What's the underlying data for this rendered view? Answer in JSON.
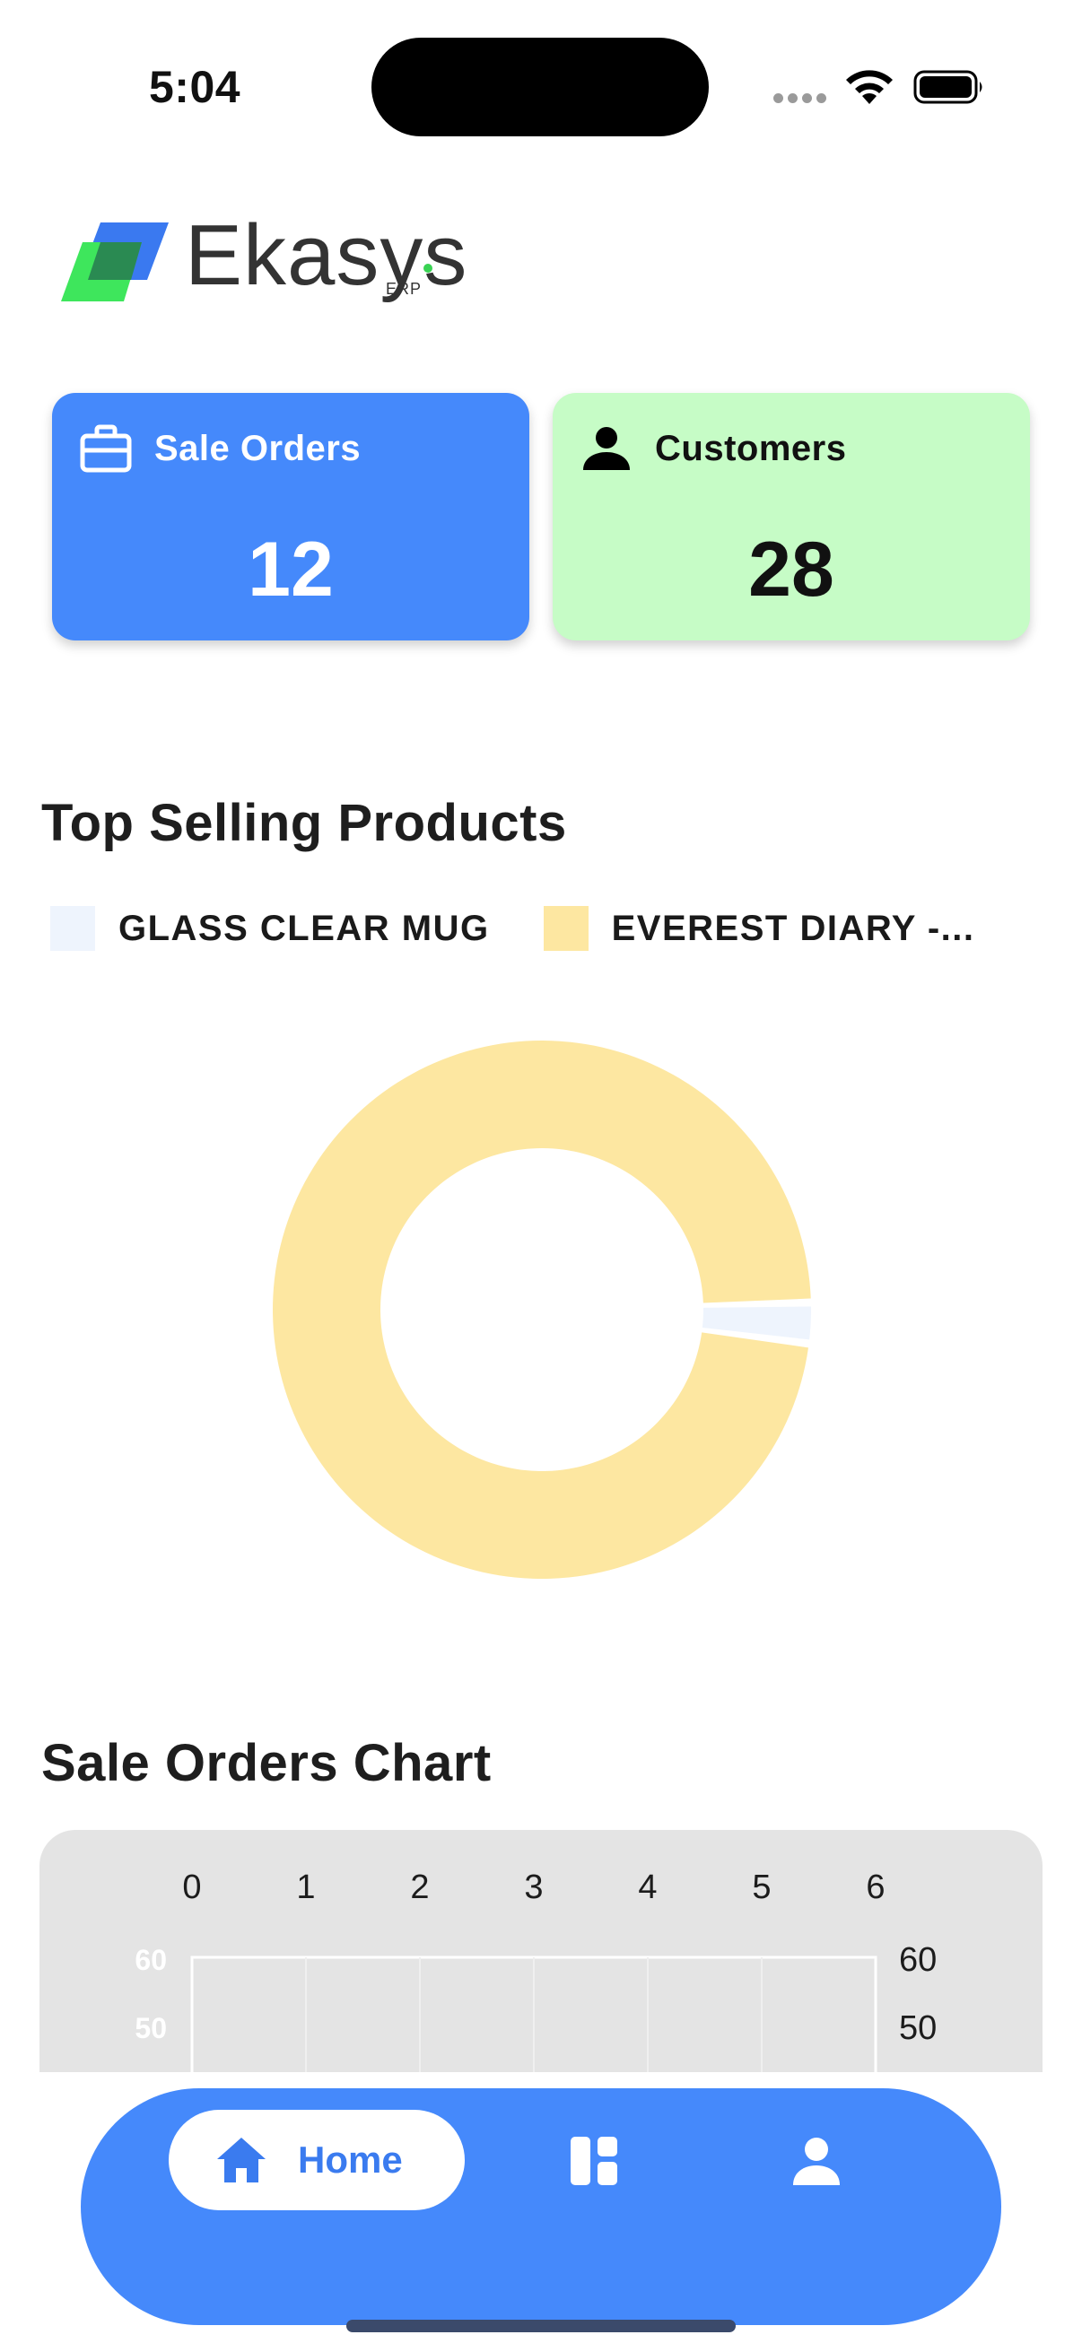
{
  "status_bar": {
    "time": "5:04"
  },
  "logo": {
    "name": "Ekasys",
    "suffix": "ERP"
  },
  "cards": [
    {
      "title": "Sale Orders",
      "value": "12",
      "icon": "briefcase-icon",
      "color": "#4589fb"
    },
    {
      "title": "Customers",
      "value": "28",
      "icon": "person-icon",
      "color": "#c6fcc6"
    }
  ],
  "sections": {
    "top_selling": "Top Selling Products",
    "sale_orders_chart": "Sale Orders Chart"
  },
  "chart_data": [
    {
      "type": "pie",
      "title": "Top Selling Products",
      "donut": true,
      "categories": [
        "GLASS CLEAR MUG",
        "EVEREST DIARY -..."
      ],
      "values": [
        1,
        40
      ],
      "colors": [
        "#eef4fd",
        "#fde7a1"
      ],
      "legend": "top"
    },
    {
      "type": "line",
      "title": "Sale Orders Chart",
      "x_ticks": [
        "0",
        "1",
        "2",
        "3",
        "4",
        "5",
        "6"
      ],
      "y_ticks_left": [
        "60",
        "50"
      ],
      "y_ticks_right": [
        "60",
        "50"
      ],
      "xlim": [
        0,
        6
      ],
      "grid": true,
      "background": "#e4e4e4"
    }
  ],
  "bottom_nav": {
    "items": [
      {
        "label": "Home",
        "icon": "home-icon",
        "active": true
      },
      {
        "label": "",
        "icon": "dashboard-icon",
        "active": false
      },
      {
        "label": "",
        "icon": "profile-icon",
        "active": false
      }
    ],
    "color": "#4589fb"
  }
}
